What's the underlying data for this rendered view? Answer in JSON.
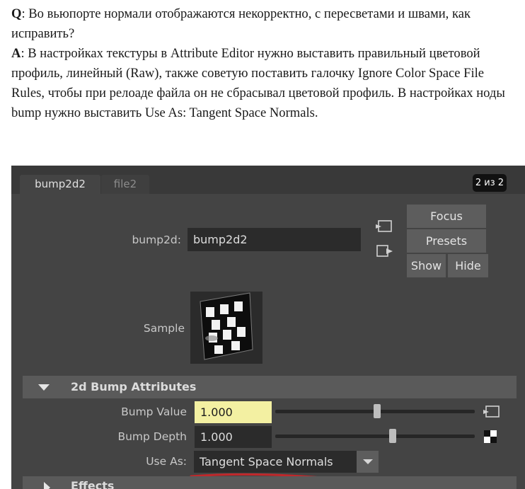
{
  "article": {
    "q_label": "Q",
    "q_text": ": Во вьюпорте нормали отображаются некорректно, с пересветами и швами, как исправить?",
    "a_label": "A",
    "a_text": ": В настройках текстуры в Attribute Editor нужно выставить правильный цветовой профиль, линейный (Raw), также советую поставить галочку Ignore Color Space File Rules, чтобы при релоаде файла он не сбрасывал цветовой профиль. В настройках ноды bump нужно выставить Use As: Tangent Space Normals."
  },
  "editor": {
    "tabs": [
      {
        "label": "bump2d2",
        "active": true
      },
      {
        "label": "file2",
        "active": false
      }
    ],
    "counter": "2 из 2",
    "node_label": "bump2d:",
    "node_name": "bump2d2",
    "buttons": {
      "focus": "Focus",
      "presets": "Presets",
      "show": "Show",
      "hide": "Hide"
    },
    "sample_label": "Sample",
    "section_title": "2d Bump Attributes",
    "bump_value_label": "Bump Value",
    "bump_value": "1.000",
    "bump_value_level": 0.51,
    "bump_depth_label": "Bump Depth",
    "bump_depth": "1.000",
    "bump_depth_level": 0.59,
    "use_as_label": "Use As:",
    "use_as_value": "Tangent Space Normals",
    "next_section_title": "Effects",
    "colors": {
      "panel_bg": "#444444",
      "field_bg": "#2b2b2b",
      "highlight_field": "#f3f0a2",
      "annotation_underline": "#c0282b"
    }
  }
}
